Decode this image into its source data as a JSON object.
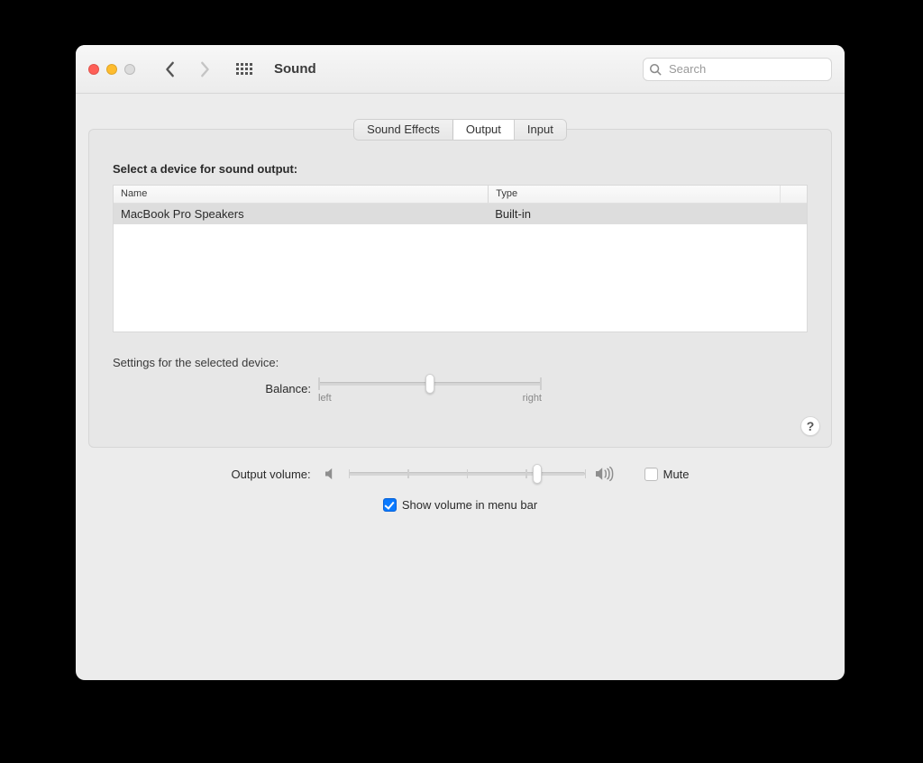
{
  "window": {
    "title": "Sound",
    "search_placeholder": "Search"
  },
  "tabs": {
    "sound_effects": "Sound Effects",
    "output": "Output",
    "input": "Input",
    "selected": "output"
  },
  "panel": {
    "select_device_heading": "Select a device for sound output:",
    "columns": {
      "name": "Name",
      "type": "Type"
    },
    "devices": [
      {
        "name": "MacBook Pro Speakers",
        "type": "Built-in",
        "selected": true
      }
    ],
    "settings_heading": "Settings for the selected device:",
    "balance": {
      "label": "Balance:",
      "left": "left",
      "right": "right",
      "value_pct": 50
    },
    "help": "?"
  },
  "bottom": {
    "output_volume_label": "Output volume:",
    "volume_pct": 80,
    "mute_label": "Mute",
    "mute_checked": false,
    "menubar_label": "Show volume in menu bar",
    "menubar_checked": true
  }
}
